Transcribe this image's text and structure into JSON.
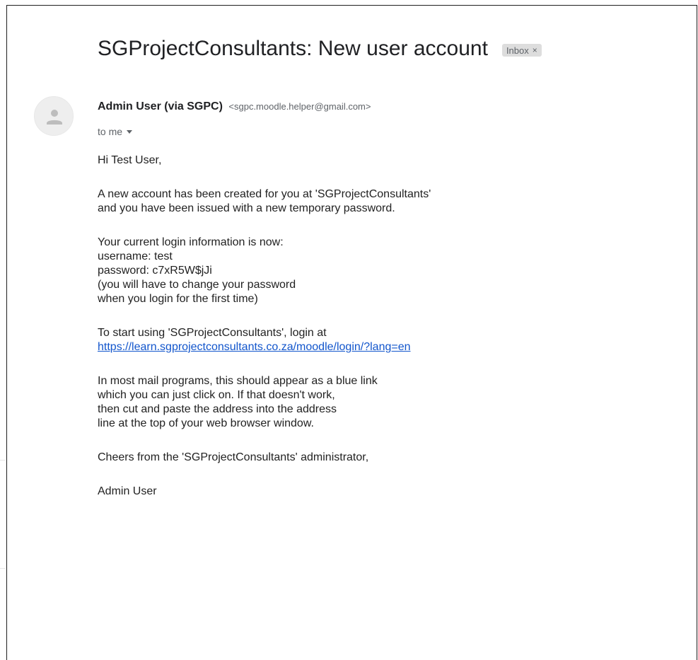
{
  "email": {
    "subject": "SGProjectConsultants: New user account",
    "label": "Inbox",
    "label_close": "×",
    "sender_name": "Admin User (via SGPC)",
    "sender_email": "<sgpc.moodle.helper@gmail.com>",
    "recipient": "to me",
    "avatar_icon": "person-icon",
    "body": {
      "greeting": "Hi Test User,",
      "p1_line1": "A new account has been created for you at 'SGProjectConsultants'",
      "p1_line2": "and you have been issued with a new temporary password.",
      "p2_line1": "Your current login information is now:",
      "p2_line2": "username: test",
      "p2_line3": "password: c7xR5W$jJi",
      "p2_line4": "(you will have to change your password",
      "p2_line5": "when you login for the first time)",
      "p3_line1": "To start using 'SGProjectConsultants', login at",
      "login_link": "https://learn.sgprojectconsultants.co.za/moodle/login/?lang=en",
      "p4_line1": "In most mail programs, this should appear as a blue link",
      "p4_line2": "which you can just click on. If that doesn't work,",
      "p4_line3": "then cut and paste the address into the address",
      "p4_line4": "line at the top of your web browser window.",
      "p5_line1": "Cheers from the 'SGProjectConsultants' administrator,",
      "signature": "Admin User"
    }
  },
  "colors": {
    "link": "#1155cc",
    "label_bg": "#dddddd",
    "muted_text": "#5f6368"
  }
}
